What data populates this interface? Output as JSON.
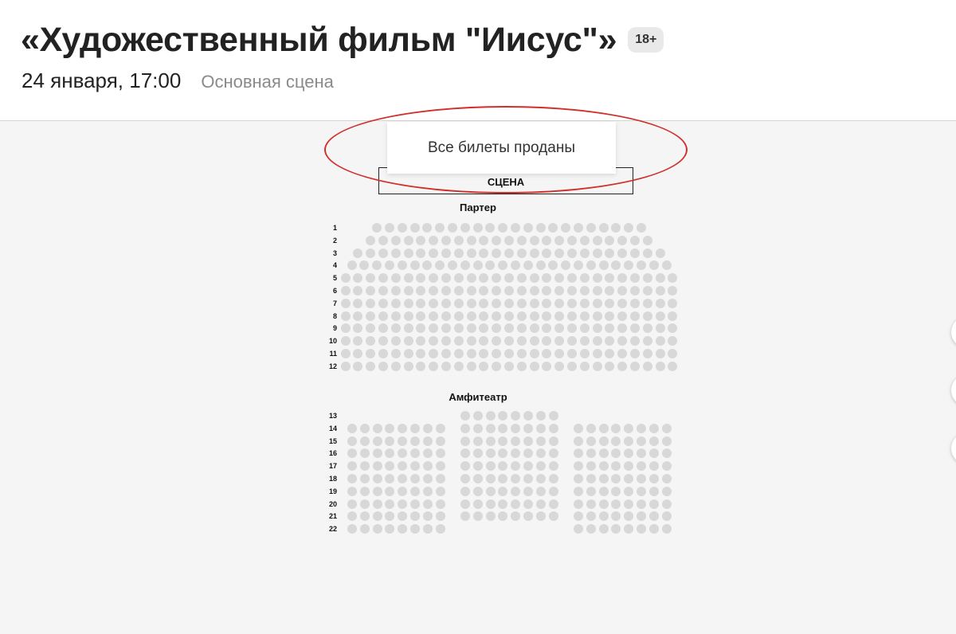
{
  "event": {
    "title": "«Художественный фильм \"Иисус\"»",
    "age_rating": "18+",
    "datetime": "24 января, 17:00",
    "venue": "Основная сцена"
  },
  "stage": {
    "label": "СЦЕНА",
    "status_message": "Все билеты проданы"
  },
  "colors": {
    "seat_unavailable": "#d8d8d8",
    "highlight": "#d0302b"
  },
  "hall": {
    "parterre": {
      "label": "Партер",
      "rows": [
        {
          "number": "1",
          "seats": 22
        },
        {
          "number": "2",
          "seats": 23
        },
        {
          "number": "3",
          "seats": 25
        },
        {
          "number": "4",
          "seats": 26
        },
        {
          "number": "5",
          "seats": 27
        },
        {
          "number": "6",
          "seats": 27
        },
        {
          "number": "7",
          "seats": 27
        },
        {
          "number": "8",
          "seats": 27
        },
        {
          "number": "9",
          "seats": 27
        },
        {
          "number": "10",
          "seats": 27
        },
        {
          "number": "11",
          "seats": 27
        },
        {
          "number": "12",
          "seats": 27
        }
      ]
    },
    "amphitheater": {
      "label": "Амфитеатр",
      "rows": [
        {
          "number": "13",
          "blocks": [
            0,
            8,
            0
          ]
        },
        {
          "number": "14",
          "blocks": [
            8,
            8,
            8
          ]
        },
        {
          "number": "15",
          "blocks": [
            8,
            8,
            8
          ]
        },
        {
          "number": "16",
          "blocks": [
            8,
            8,
            8
          ]
        },
        {
          "number": "17",
          "blocks": [
            8,
            8,
            8
          ]
        },
        {
          "number": "18",
          "blocks": [
            8,
            8,
            8
          ]
        },
        {
          "number": "19",
          "blocks": [
            8,
            8,
            8
          ]
        },
        {
          "number": "20",
          "blocks": [
            8,
            8,
            8
          ]
        },
        {
          "number": "21",
          "blocks": [
            8,
            8,
            8
          ]
        },
        {
          "number": "22",
          "blocks": [
            8,
            0,
            8
          ]
        }
      ]
    }
  }
}
